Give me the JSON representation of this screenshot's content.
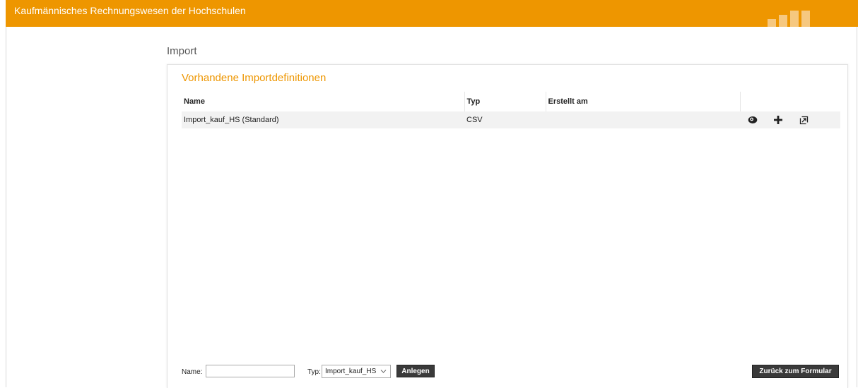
{
  "header": {
    "app_title": "Kaufmännisches Rechnungswesen der Hochschulen",
    "bar_color": "#ee9600"
  },
  "page": {
    "title": "Import"
  },
  "panel": {
    "title": "Vorhandene Importdefinitionen",
    "columns": [
      "Name",
      "Typ",
      "Erstellt am",
      ""
    ],
    "rows": [
      {
        "name": "Import_kauf_HS (Standard)",
        "typ": "CSV",
        "erstellt_am": ""
      }
    ],
    "row_actions": [
      "view-icon",
      "add-icon",
      "export-icon"
    ]
  },
  "footer": {
    "name_label": "Name:",
    "name_value": "",
    "typ_label": "Typ:",
    "typ_selected": "Import_kauf_HS",
    "create_button": "Anlegen",
    "back_button": "Zurück zum Formular"
  }
}
